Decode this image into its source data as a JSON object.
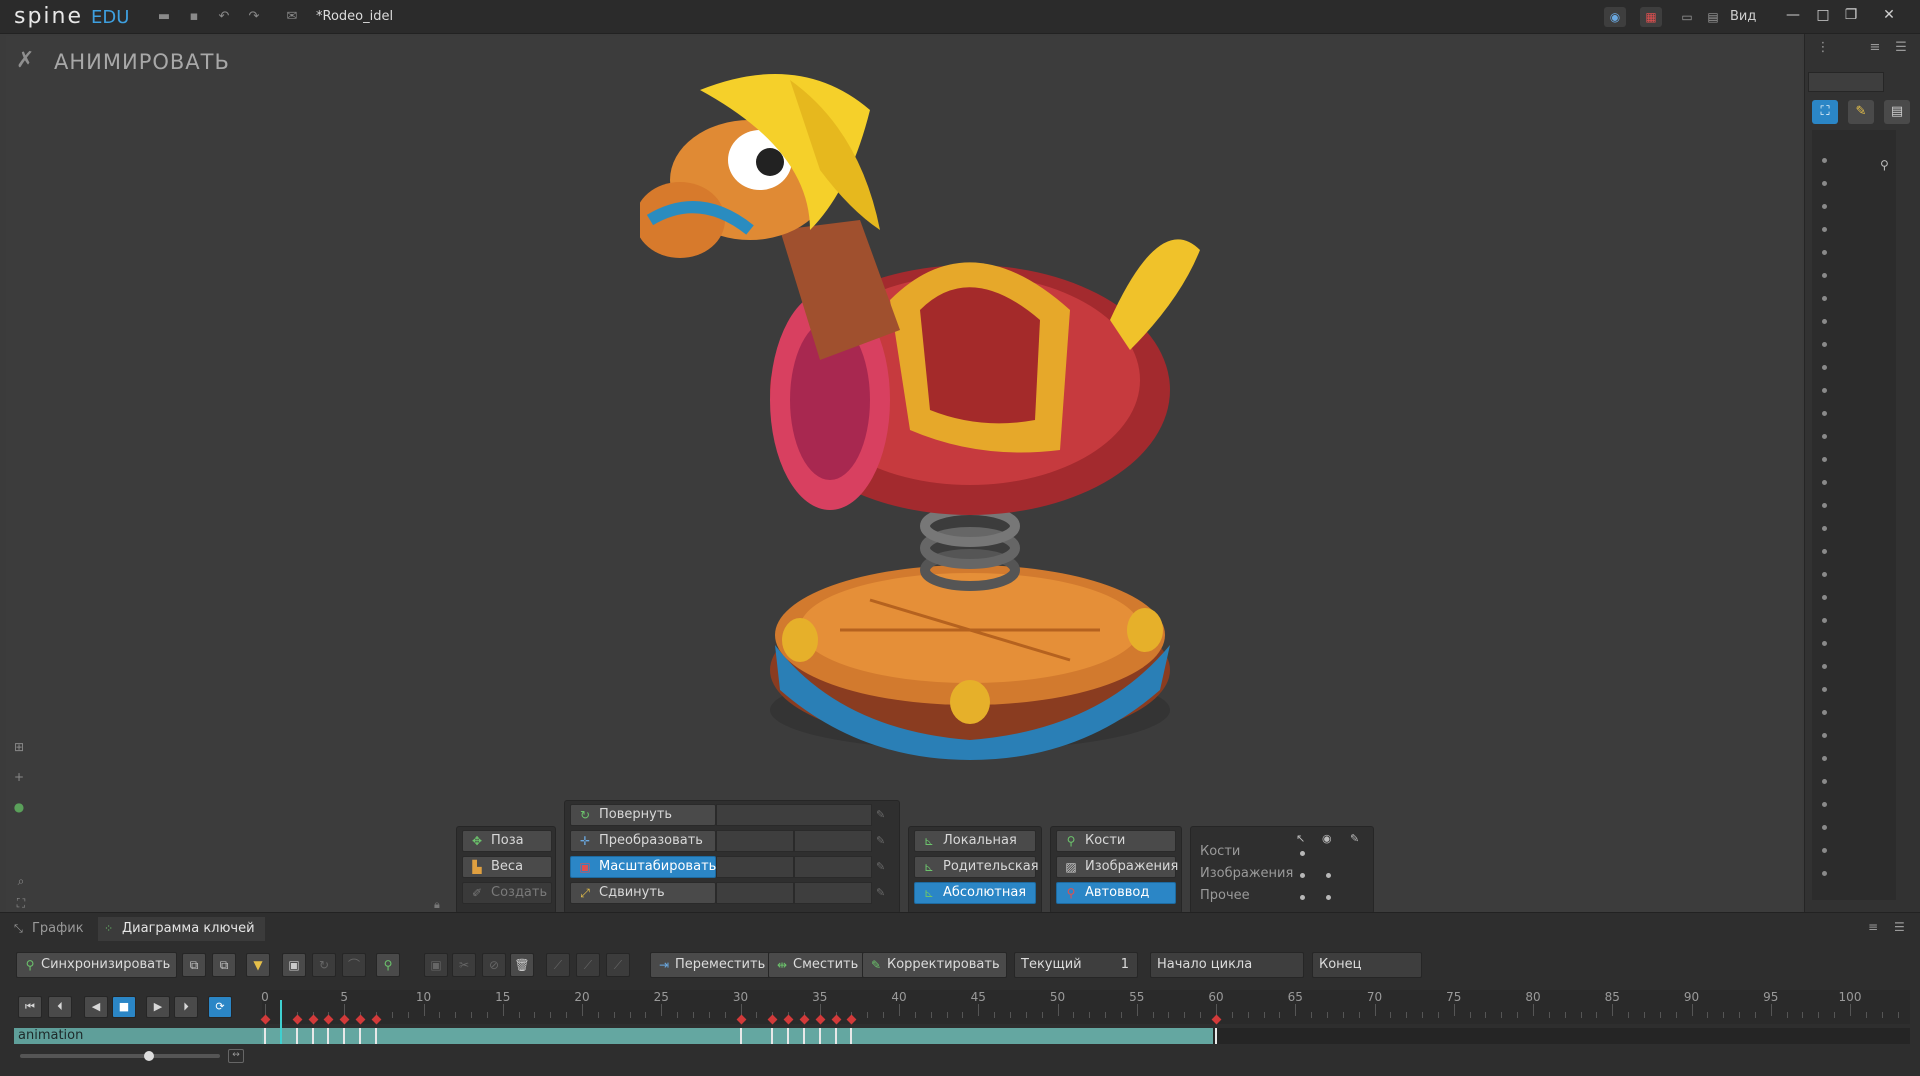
{
  "app": {
    "logo": "spine",
    "edition": "EDU",
    "doc_title": "*Rodeo_idel",
    "view_menu": "Вид"
  },
  "viewport": {
    "mode_label": "АНИМИРОВАТЬ"
  },
  "tools": {
    "pose": "Поза",
    "weights": "Веса",
    "create": "Создать",
    "rotate": "Повернуть",
    "translate": "Преобразовать",
    "scale": "Масштабировать",
    "shear": "Сдвинуть",
    "local": "Локальная",
    "parent": "Родительская",
    "absolute": "Абсолютная",
    "bones": "Кости",
    "images": "Изображения",
    "autokey": "Автоввод",
    "vis_bones": "Кости",
    "vis_images": "Изображения",
    "vis_other": "Прочее"
  },
  "bottom": {
    "tab_graph": "График",
    "tab_dopesheet": "Диаграмма ключей",
    "sync": "Синхронизировать",
    "move": "Переместить",
    "offset": "Сместить",
    "adjust": "Корректировать",
    "current_label": "Текущий",
    "current_value": "1",
    "loop_start": "Начало цикла",
    "end": "Конец",
    "track_name": "animation"
  },
  "ruler": {
    "ticks": [
      "0",
      "5",
      "10",
      "15",
      "20",
      "25",
      "30",
      "35",
      "40",
      "45",
      "50",
      "55",
      "60",
      "65",
      "70",
      "75",
      "80",
      "85",
      "90",
      "95",
      "100"
    ],
    "current_frame": 1,
    "keys": [
      0,
      2,
      3,
      4,
      5,
      6,
      7,
      30,
      32,
      33,
      34,
      35,
      36,
      37,
      60
    ],
    "animation_end": 60
  },
  "colors": {
    "accent": "#2b86c6",
    "track": "#64a7a1",
    "key": "#d23a3a"
  }
}
